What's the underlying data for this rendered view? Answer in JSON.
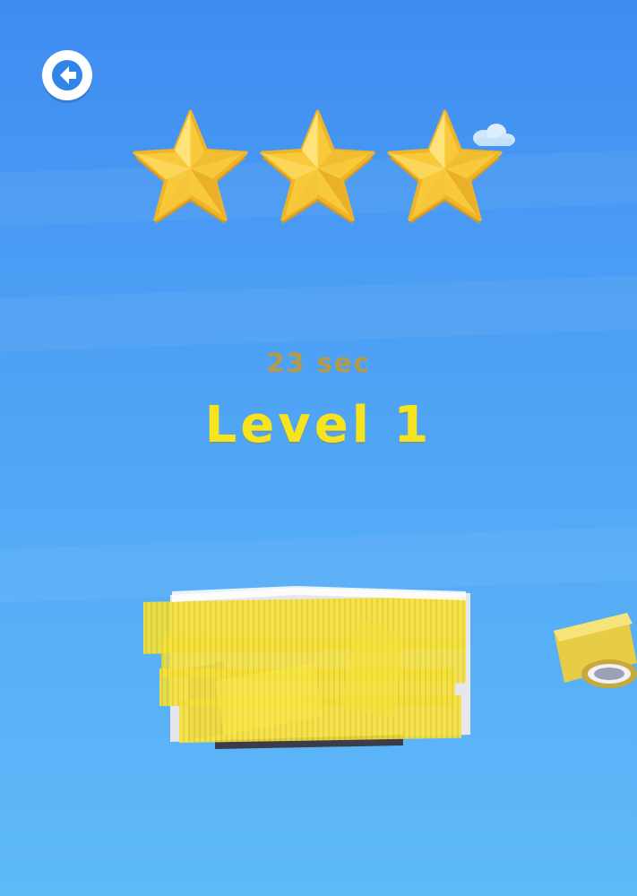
{
  "header": {
    "back_icon": "back-arrow-icon"
  },
  "rating": {
    "stars_earned": 3,
    "stars_total": 3,
    "star_color": "#f8c93a"
  },
  "result": {
    "time_text": "23 sec",
    "level_text": "Level 1"
  },
  "colors": {
    "sky_top": "#3f8cf1",
    "sky_bottom": "#5fbaf8",
    "tape": "#f4e03a",
    "back_button": "#ffffff",
    "level_text": "#f7e41f"
  }
}
